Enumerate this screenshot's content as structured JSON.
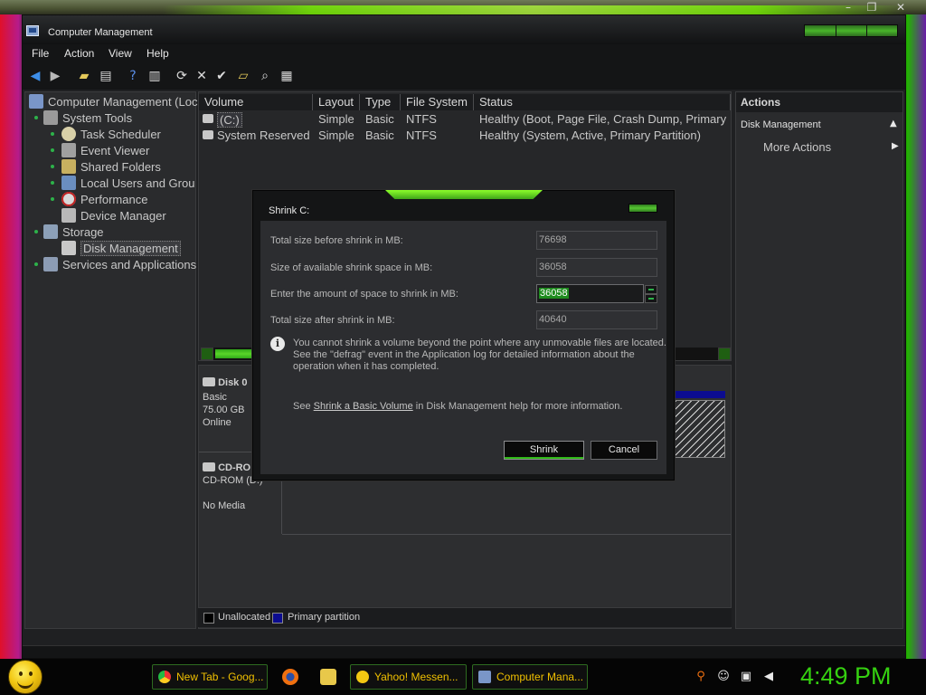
{
  "window": {
    "title": "Computer Management"
  },
  "menu": [
    "File",
    "Action",
    "View",
    "Help"
  ],
  "tree": {
    "root": "Computer Management (Loc",
    "items": [
      "System Tools",
      "Task Scheduler",
      "Event Viewer",
      "Shared Folders",
      "Local Users and Grou",
      "Performance",
      "Device Manager",
      "Storage",
      "Disk Management",
      "Services and Applications"
    ]
  },
  "volumes": {
    "columns": [
      "Volume",
      "Layout",
      "Type",
      "File System",
      "Status"
    ],
    "rows": [
      [
        "(C:)",
        "Simple",
        "Basic",
        "NTFS",
        "Healthy (Boot, Page File, Crash Dump, Primary"
      ],
      [
        "System Reserved",
        "Simple",
        "Basic",
        "NTFS",
        "Healthy (System, Active, Primary Partition)"
      ]
    ]
  },
  "disks": {
    "disk0": {
      "name": "Disk 0",
      "type": "Basic",
      "size": "75.00 GB",
      "state": "Online"
    },
    "cdrom": {
      "name": "CD-RO",
      "type": "CD-ROM (D:)",
      "state": "No Media"
    }
  },
  "legend": [
    "Unallocated",
    "Primary partition"
  ],
  "actions": {
    "header": "Actions",
    "section": "Disk Management",
    "more": "More Actions"
  },
  "dialog": {
    "title": "Shrink C:",
    "fields": [
      {
        "label": "Total size before shrink in MB:",
        "value": "76698"
      },
      {
        "label": "Size of available shrink space in MB:",
        "value": "36058"
      },
      {
        "label": "Enter the amount of space to shrink in MB:",
        "value": "36058"
      },
      {
        "label": "Total size after shrink in MB:",
        "value": "40640"
      }
    ],
    "note_lines": [
      "You cannot shrink a volume beyond the point where any unmovable files are located.",
      "See the \"defrag\" event in the Application log for detailed information about the",
      "operation when it has completed."
    ],
    "help_prefix": "See ",
    "help_link": "Shrink a Basic Volume",
    "help_suffix": " in Disk Management help for more information.",
    "shrink_label": "Shrink",
    "cancel_label": "Cancel"
  },
  "taskbar": {
    "items": [
      "New Tab - Goog...",
      "Yahoo! Messen...",
      "Computer Mana..."
    ],
    "clock": "4:49 PM"
  },
  "colors": {
    "accent_green": "#2db24a",
    "clock_green": "#35d010",
    "primary_partition": "#0c0c90"
  }
}
